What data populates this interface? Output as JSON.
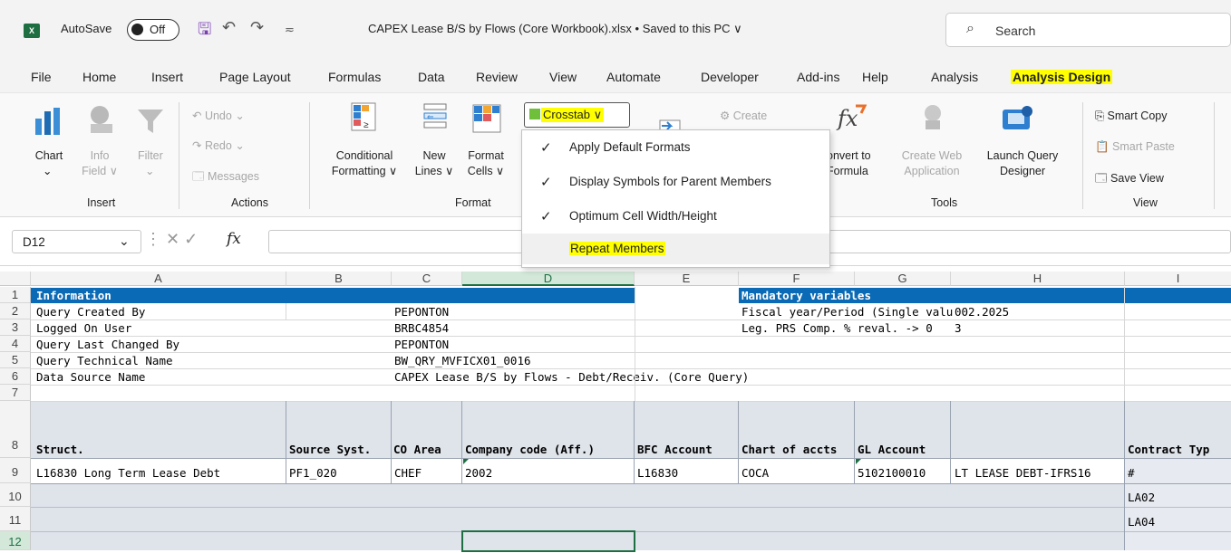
{
  "titlebar": {
    "app_badge": "X",
    "autosave_label": "AutoSave",
    "autosave_state": "Off",
    "document_title": "CAPEX Lease B/S by Flows (Core Workbook).xlsx • Saved to this PC ∨",
    "search_placeholder": "Search"
  },
  "tabs": [
    "File",
    "Home",
    "Insert",
    "Page Layout",
    "Formulas",
    "Data",
    "Review",
    "View",
    "Automate",
    "Developer",
    "Add-ins",
    "Help",
    "Analysis",
    "Analysis Design"
  ],
  "active_tab": "Analysis Design",
  "ribbon": {
    "insert": {
      "chart": "Chart",
      "info_field": "Info\nField ∨",
      "filter": "Filter",
      "group": "Insert"
    },
    "actions": {
      "undo": "Undo",
      "redo": "Redo",
      "messages": "Messages",
      "group": "Actions"
    },
    "format": {
      "cond_formatting": "Conditional\nFormatting ∨",
      "new_lines": "New\nLines ∨",
      "format_cells": "Format\nCells ∨",
      "group": "Format"
    },
    "crosstab": "Crosstab ∨",
    "create": "Create",
    "tools": {
      "convert": "onvert to\nFormula",
      "create_web": "Create Web\nApplication",
      "launch_query": "Launch Query\nDesigner",
      "group": "Tools"
    },
    "view": {
      "smart_copy": "Smart Copy",
      "smart_paste": "Smart Paste",
      "save_view": "Save View",
      "group": "View"
    }
  },
  "crosstab_menu": [
    {
      "label": "Apply Default Formats",
      "checked": true
    },
    {
      "label": "Display Symbols for Parent Members",
      "checked": true
    },
    {
      "label": "Optimum Cell Width/Height",
      "checked": true
    },
    {
      "label": "Repeat Members",
      "checked": false
    }
  ],
  "formula_bar": {
    "name_box": "D12",
    "fx": "fx"
  },
  "columns": [
    "A",
    "B",
    "C",
    "D",
    "E",
    "F",
    "G",
    "H",
    "I"
  ],
  "rows": [
    "1",
    "2",
    "3",
    "4",
    "5",
    "6",
    "7",
    "8",
    "9",
    "10",
    "11",
    "12"
  ],
  "sheet": {
    "r1_info": "Information",
    "r1_mandatory": "Mandatory variables",
    "r2_label": "Query Created By",
    "r2_value": "PEPONTON",
    "r2_f": "Fiscal year/Period (Single valu",
    "r2_g": "002.2025",
    "r3_label": "Logged On User",
    "r3_value": "BRBC4854",
    "r3_f": "Leg. PRS Comp. % reval. -> 0",
    "r3_g": "3",
    "r4_label": "Query Last Changed By",
    "r4_value": "PEPONTON",
    "r5_label": "Query Technical Name",
    "r5_value": "BW_QRY_MVFICX01_0016",
    "r6_label": "Data Source Name",
    "r6_value": "CAPEX Lease B/S by Flows - Debt/Receiv. (Core Query)",
    "headers": [
      "Struct.",
      "Source Syst.",
      "CO Area",
      "Company code (Aff.)",
      "BFC Account",
      "Chart of accts",
      "GL Account",
      "",
      "Contract Typ"
    ],
    "r9": [
      "L16830 Long Term Lease Debt",
      "PF1_020",
      "CHEF",
      "2002",
      "L16830",
      "COCA",
      "5102100010",
      "LT LEASE DEBT-IFRS16",
      "#"
    ],
    "r10_i": "LA02",
    "r11_i": "LA04"
  }
}
